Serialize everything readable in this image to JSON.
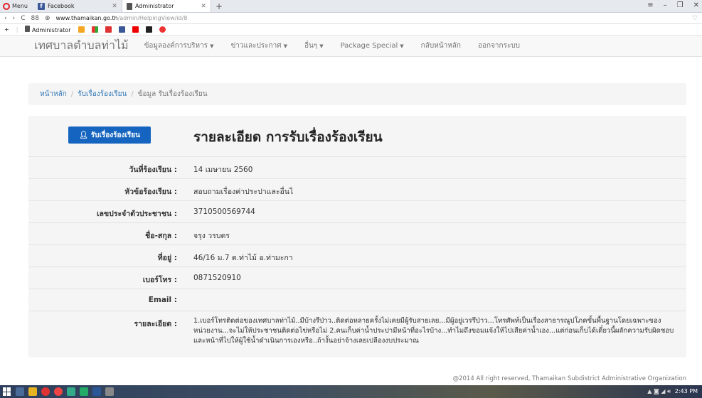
{
  "browser": {
    "menu_label": "Menu",
    "tabs": [
      {
        "label": "Facebook",
        "icon": "facebook-icon"
      },
      {
        "label": "Administrator",
        "icon": "document-icon",
        "active": true
      }
    ],
    "url_domain": "www.thamaikan.go.th",
    "url_path": "/admin/HelpingView/id/8",
    "bookmarks": [
      "Administrator"
    ]
  },
  "site": {
    "brand": "เทศบาลตำบลท่าไม้",
    "nav": [
      {
        "label": "ข้อมูลองค์การบริหาร",
        "dropdown": true
      },
      {
        "label": "ข่าวและประกาศ",
        "dropdown": true
      },
      {
        "label": "อื่นๆ",
        "dropdown": true
      },
      {
        "label": "Package Special",
        "dropdown": true
      },
      {
        "label": "กลับหน้าหลัก",
        "dropdown": false
      },
      {
        "label": "ออกจากระบบ",
        "dropdown": false
      }
    ]
  },
  "breadcrumb": {
    "home": "หน้าหลัก",
    "section": "รับเรื่องร้องเรียน",
    "current": "ข้อมูล รับเรื่องร้องเรียน"
  },
  "detail": {
    "button_label": "รับเรื่องร้องเรียน",
    "title": "รายละเอียด การรับเรื่องร้องเรียน",
    "fields": [
      {
        "label": "วันที่ร้องเรียน :",
        "value": "14 เมษายน 2560"
      },
      {
        "label": "หัวข้อร้องเรียน :",
        "value": "สอบถามเรื่องค่าประปาและอื่นไ"
      },
      {
        "label": "เลขประจำตัวประชาชน :",
        "value": "3710500569744"
      },
      {
        "label": "ชื่อ-สกุล :",
        "value": "จรุง วรบตร"
      },
      {
        "label": "ที่อยู่ :",
        "value": "46/16 ม.7 ต.ท่าไม้ อ.ท่ามะกา"
      },
      {
        "label": "เบอร์โทร :",
        "value": "0871520910"
      },
      {
        "label": "Email :",
        "value": ""
      },
      {
        "label": "รายละเอียด :",
        "value": "1.เบอร์โทรติดต่อของเทศบาลท่าไม้..มีบ้างรึป่าว..ติดต่อหลายครั้งไม่เคยมีผู้รับสายเลย...มีผู้อยู่เวรรึป่าว...โทรศัพท์เป็นเรื่องสาธารณูปโภคขั้นพื้นฐานโดยเฉพาะของหน่วยงาน...จะไม่ให้ประชาชนติดต่อไข่หรือไม่ 2.คนเก็บค่าน้ำประปามีหน้าที่อะไรบ้าง...ทำไมถึงขอมแจ้งให้ไปเสียค่าน้ำเอง...แต่ก่อนเก็บได้เดี๋ยวนี้ผลักความรับผิดชอบและหน้าที่ไปให้ผู้ใช้น้ำดำเนินการเองหรือ..ถ้างั้นอย่าจ้างเลยเปลืองงบประมาณ"
      }
    ]
  },
  "footer": {
    "text": "@2014 All right reserved, Thamaikan Subdistrict Administrative Organization"
  },
  "taskbar": {
    "clock": "2:43 PM"
  }
}
